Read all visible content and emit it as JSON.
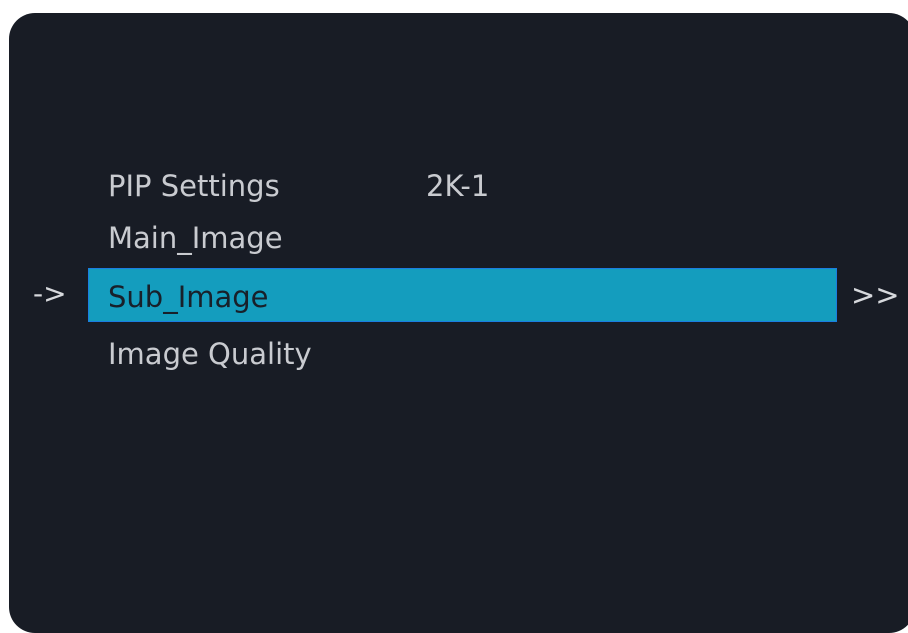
{
  "menu": {
    "title": "PIP Settings",
    "title_value": "2K-1",
    "items": [
      {
        "label": "Main_Image"
      },
      {
        "label": "Sub_Image",
        "selected": true
      },
      {
        "label": "Image Quality"
      }
    ],
    "cursor_glyph": "->",
    "submenu_glyph": ">>"
  },
  "colors": {
    "panel_background": "#181c25",
    "text": "#c9cbd0",
    "highlight": "#149dbe",
    "highlight_border": "#1b7de0",
    "selected_text": "#18202a"
  }
}
